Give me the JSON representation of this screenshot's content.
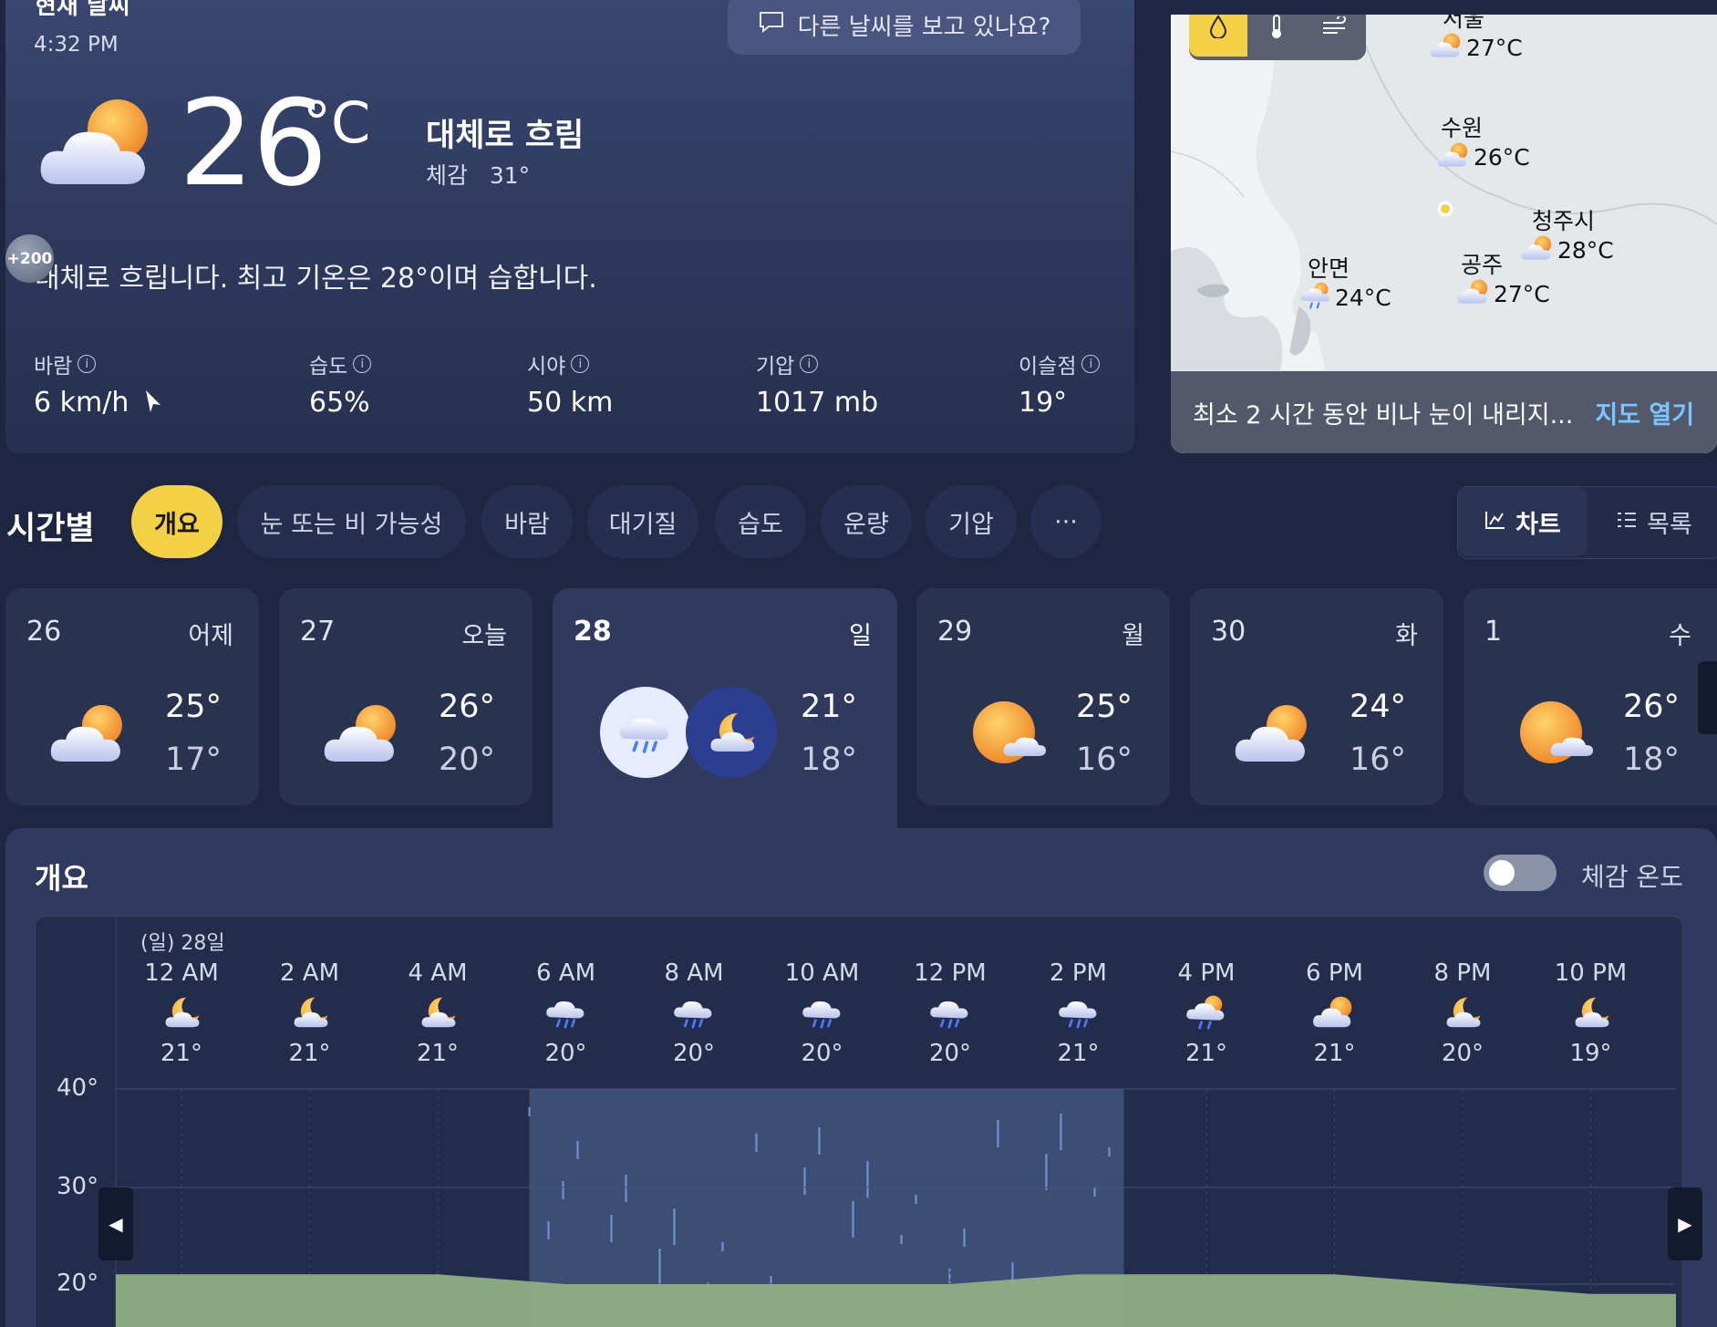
{
  "current": {
    "title_partial": "현재 날씨",
    "time": "4:32 PM",
    "feedback_prompt": "다른 날씨를 보고 있나요?",
    "temperature": "26",
    "unit": "°C",
    "condition": "대체로 흐림",
    "feels_like_label": "체감",
    "feels_like_value": "31°",
    "badge": "+200",
    "summary": "대체로 흐립니다. 최고 기온은 28°이며 습합니다.",
    "metrics": [
      {
        "label": "바람",
        "value": "6 km/h"
      },
      {
        "label": "습도",
        "value": "65%"
      },
      {
        "label": "시야",
        "value": "50 km"
      },
      {
        "label": "기압",
        "value": "1017 mb"
      },
      {
        "label": "이슬점",
        "value": "19°"
      }
    ],
    "info_glyph": "i"
  },
  "map": {
    "cities": [
      {
        "name": "서울",
        "temp": "27°C"
      },
      {
        "name": "수원",
        "temp": "26°C"
      },
      {
        "name": "청주시",
        "temp": "28°C"
      },
      {
        "name": "공주",
        "temp": "27°C"
      },
      {
        "name": "안면",
        "temp": "24°C"
      }
    ],
    "notice": "최소 2 시간 동안 비나 눈이 내리지...",
    "open_link": "지도 열기",
    "layer_icons": [
      "precipitation-icon",
      "temperature-icon",
      "wind-icon"
    ]
  },
  "hourly": {
    "title": "시간별",
    "tabs": [
      "개요",
      "눈 또는 비 가능성",
      "바람",
      "대기질",
      "습도",
      "운량",
      "기압",
      "···"
    ],
    "active_tab": "개요",
    "view_chart": "차트",
    "view_list": "목록"
  },
  "days": [
    {
      "num": "26",
      "name": "어제",
      "hi": "25°",
      "lo": "17°",
      "icon": "partly-cloudy-icon"
    },
    {
      "num": "27",
      "name": "오늘",
      "hi": "26°",
      "lo": "20°",
      "icon": "partly-cloudy-icon"
    },
    {
      "num": "28",
      "name": "일",
      "hi": "21°",
      "lo": "18°",
      "icon": "rain-icon"
    },
    {
      "num": "29",
      "name": "월",
      "hi": "25°",
      "lo": "16°",
      "icon": "mostly-sunny-icon"
    },
    {
      "num": "30",
      "name": "화",
      "hi": "24°",
      "lo": "16°",
      "icon": "partly-cloudy-icon"
    },
    {
      "num": "1",
      "name": "수",
      "hi": "26°",
      "lo": "18°",
      "icon": "mostly-sunny-icon"
    }
  ],
  "overview": {
    "title": "개요",
    "toggle_label": "체감 온도",
    "toggle_on": false,
    "date_label": "(일) 28일",
    "hours": [
      {
        "time": "12 AM",
        "temp": "21°",
        "icon": "night-partly-cloudy-icon"
      },
      {
        "time": "2 AM",
        "temp": "21°",
        "icon": "night-partly-cloudy-icon"
      },
      {
        "time": "4 AM",
        "temp": "21°",
        "icon": "night-partly-cloudy-icon"
      },
      {
        "time": "6 AM",
        "temp": "20°",
        "icon": "rain-icon"
      },
      {
        "time": "8 AM",
        "temp": "20°",
        "icon": "rain-icon"
      },
      {
        "time": "10 AM",
        "temp": "20°",
        "icon": "heavy-rain-icon"
      },
      {
        "time": "12 PM",
        "temp": "20°",
        "icon": "heavy-rain-icon"
      },
      {
        "time": "2 PM",
        "temp": "21°",
        "icon": "rain-icon"
      },
      {
        "time": "4 PM",
        "temp": "21°",
        "icon": "sun-rain-icon"
      },
      {
        "time": "6 PM",
        "temp": "21°",
        "icon": "partly-cloudy-icon"
      },
      {
        "time": "8 PM",
        "temp": "20°",
        "icon": "night-partly-cloudy-icon"
      },
      {
        "time": "10 PM",
        "temp": "19°",
        "icon": "night-partly-cloudy-icon"
      }
    ],
    "y_axis": [
      "40°",
      "30°",
      "20°"
    ]
  },
  "colors": {
    "accent_yellow": "#f4d046",
    "link_blue": "#7cc4ff",
    "temp_area_green": "#8fae86",
    "rain_band": "#3d4e74"
  }
}
